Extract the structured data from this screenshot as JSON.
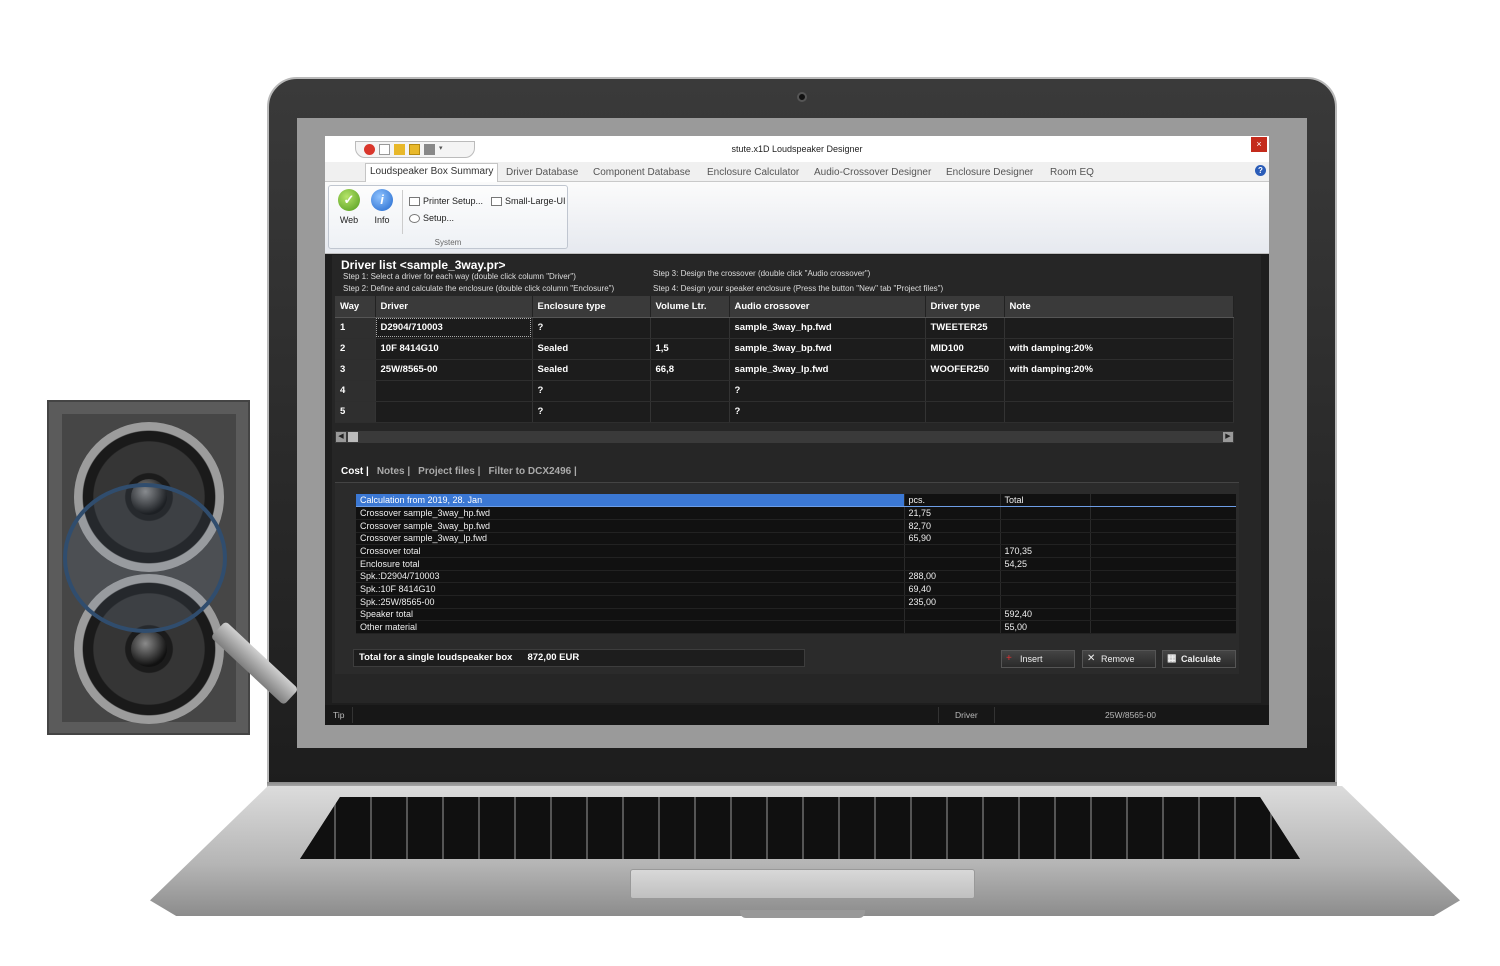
{
  "window": {
    "title": "stute.x1D Loudspeaker Designer",
    "close_label": "×"
  },
  "menu": {
    "tabs": [
      {
        "label": "Loudspeaker Box Summary"
      },
      {
        "label": "Driver Database"
      },
      {
        "label": "Component Database"
      },
      {
        "label": "Enclosure Calculator"
      },
      {
        "label": "Audio-Crossover Designer"
      },
      {
        "label": "Enclosure Designer"
      },
      {
        "label": "Room EQ"
      }
    ],
    "help_label": "?"
  },
  "ribbon": {
    "group_label": "System",
    "web_label": "Web",
    "info_label": "Info",
    "printer_setup_label": "Printer Setup...",
    "setup_label": "Setup...",
    "small_large_ui_label": "Small-Large-UI"
  },
  "driver_list": {
    "title": "Driver list <sample_3way.pr>",
    "step1": "Step 1: Select a driver for each way (double click column \"Driver\")",
    "step2": "Step 2: Define and calculate the enclosure  (double click column \"Enclosure\")",
    "step3": "Step 3: Design the crossover (double click \"Audio crossover\")",
    "step4": "Step 4: Design your speaker enclosure (Press the  button \"New\" tab \"Project files\")",
    "columns": [
      "Way",
      "Driver",
      "Enclosure type",
      "Volume Ltr.",
      "Audio crossover",
      "Driver type",
      "Note"
    ],
    "rows": [
      [
        "1",
        "D2904/710003",
        "?",
        "",
        "sample_3way_hp.fwd",
        "TWEETER25",
        ""
      ],
      [
        "2",
        "10F 8414G10",
        "Sealed",
        "1,5",
        "sample_3way_bp.fwd",
        "MID100",
        "with damping:20%"
      ],
      [
        "3",
        "25W/8565-00",
        "Sealed",
        "66,8",
        "sample_3way_lp.fwd",
        "WOOFER250",
        "with damping:20%"
      ],
      [
        "4",
        "",
        "?",
        "",
        "?",
        "",
        ""
      ],
      [
        "5",
        "",
        "?",
        "",
        "?",
        "",
        ""
      ]
    ]
  },
  "bottom_tabs": [
    {
      "label": "Cost |"
    },
    {
      "label": "Notes |"
    },
    {
      "label": "Project files |"
    },
    {
      "label": "Filter to DCX2496 |"
    }
  ],
  "cost": {
    "rows": [
      [
        "Calculation from 2019, 28. Jan",
        "pcs.",
        "Total"
      ],
      [
        "Crossover sample_3way_hp.fwd",
        "21,75",
        ""
      ],
      [
        "Crossover sample_3way_bp.fwd",
        "82,70",
        ""
      ],
      [
        "Crossover sample_3way_lp.fwd",
        "65,90",
        ""
      ],
      [
        "Crossover total",
        "",
        "170,35"
      ],
      [
        "Enclosure total",
        "",
        "54,25"
      ],
      [
        "Spk.:D2904/710003",
        "288,00",
        ""
      ],
      [
        "Spk.:10F 8414G10",
        "69,40",
        ""
      ],
      [
        "Spk.:25W/8565-00",
        "235,00",
        ""
      ],
      [
        "Speaker total",
        "",
        "592,40"
      ],
      [
        "Other material",
        "",
        "55,00"
      ]
    ],
    "total_label": "Total for a single loudspeaker box",
    "total_value": "872,00 EUR",
    "insert_label": "Insert",
    "remove_label": "Remove",
    "calculate_label": "Calculate"
  },
  "status": {
    "tip_label": "Tip",
    "driver_label": "Driver",
    "driver_value": "25W/8565-00"
  },
  "colors": {
    "accent": "#3b78d4",
    "close": "#c42b1c"
  }
}
